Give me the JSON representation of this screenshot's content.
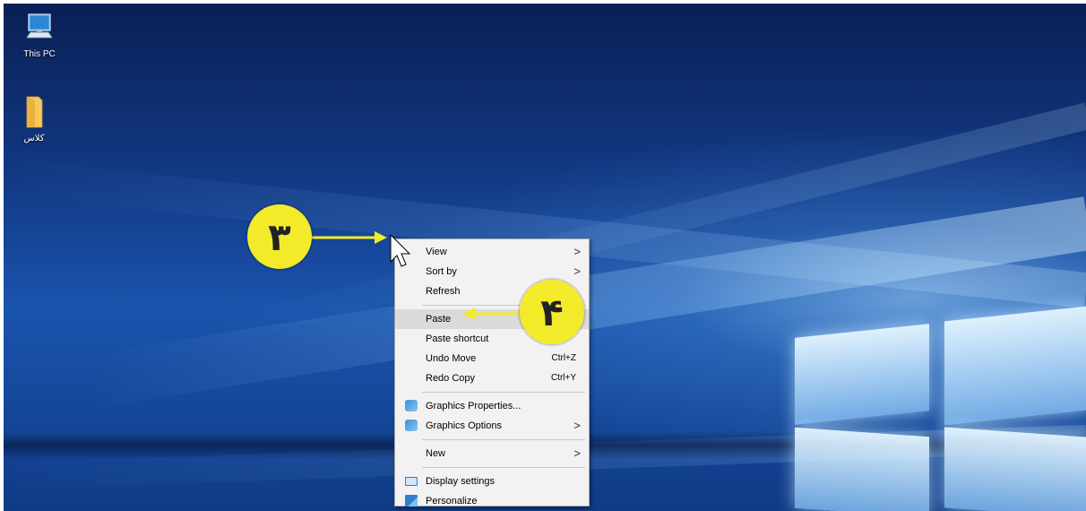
{
  "desktop": {
    "icons": [
      {
        "label": "This PC",
        "icon": "this-pc-icon"
      },
      {
        "label": "کلاس",
        "icon": "folder-icon"
      }
    ]
  },
  "callouts": {
    "step3": "۳",
    "step4": "۴"
  },
  "context_menu": {
    "items": {
      "view": {
        "label": "View",
        "submenu": true
      },
      "sort_by": {
        "label": "Sort by",
        "submenu": true
      },
      "refresh": {
        "label": "Refresh"
      },
      "paste": {
        "label": "Paste",
        "highlighted": true
      },
      "paste_shortcut": {
        "label": "Paste shortcut"
      },
      "undo_move": {
        "label": "Undo Move",
        "shortcut": "Ctrl+Z"
      },
      "redo_copy": {
        "label": "Redo Copy",
        "shortcut": "Ctrl+Y"
      },
      "graphics_properties": {
        "label": "Graphics Properties...",
        "icon": "graphics-icon"
      },
      "graphics_options": {
        "label": "Graphics Options",
        "icon": "graphics-icon",
        "submenu": true
      },
      "new": {
        "label": "New",
        "submenu": true
      },
      "display_settings": {
        "label": "Display settings",
        "icon": "display-icon"
      },
      "personalize": {
        "label": "Personalize",
        "icon": "personalize-icon"
      }
    },
    "submenu_arrow": ">"
  },
  "colors": {
    "callout_fill": "#f3ea2a",
    "menu_background": "#f2f2f2",
    "menu_highlight": "#dadada",
    "desktop_blue": "#123a86"
  }
}
